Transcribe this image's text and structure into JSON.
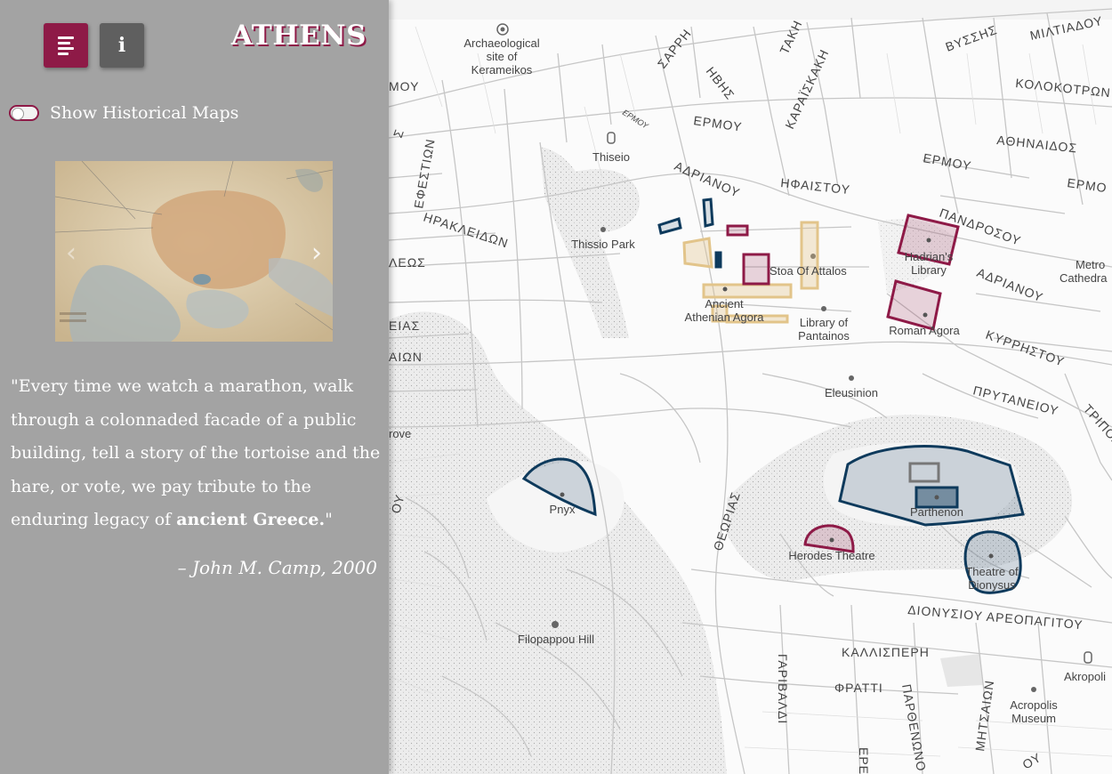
{
  "sidebar": {
    "title": "ATHENS",
    "menu_button_icon": "menu-icon",
    "info_button_icon": "info-icon",
    "info_glyph": "i",
    "toggle_label": "Show Historical Maps",
    "toggle_on": false,
    "carousel": {
      "prev_glyph": "‹",
      "next_glyph": "›"
    },
    "quote_part1": "\"Every time we watch a marathon, walk through a colonnaded facade of a public building, tell a story of the tortoise and the hare, or vote, we pay tribute to the enduring legacy of ",
    "quote_bold": "ancient Greece.",
    "quote_end": "\"",
    "attribution": "– John M. Camp, 2000"
  },
  "colors": {
    "accent": "#8e1a47",
    "sidebar": "#a3a3a3",
    "navy": "#0e3a5c",
    "sand": "#e2c48a"
  },
  "map": {
    "places": {
      "keramikos": [
        "Archaeological",
        "site of",
        "Kerameikos"
      ],
      "thiseio": "Thiseio",
      "thissio_park": "Thissio Park",
      "stoa": "Stoa Of Attalos",
      "agora": [
        "Ancient",
        "Athenian Agora"
      ],
      "pantainos": [
        "Library of",
        "Pantainos"
      ],
      "hadrians": [
        "Hadrian's",
        "Library"
      ],
      "roman_agora": "Roman Agora",
      "metro": [
        "Metro",
        "Cathedra"
      ],
      "eleusinion": "Eleusinion",
      "parthenon": "Parthenon",
      "pnyx": "Pnyx",
      "herodes": "Herodes Theatre",
      "dionysus": [
        "Theatre of",
        "Dionysus"
      ],
      "filopappou": "Filopappou Hill",
      "akropoli": "Akropoli",
      "acropolis_museum": [
        "Acropolis",
        "Museum"
      ],
      "grove": "rove"
    },
    "streets": {
      "sarri": "ΣΑΡΡΗ",
      "ivis": "ΗΒΗΣ",
      "taki": "ΤΑΚΗ",
      "karaiskaki": "ΚΑΡΑΪΣΚΑΚΗ",
      "vyssis": "ΒΥΣΣΗΣ",
      "miltiadou": "ΜΙΛΤΙΑΔΟΥ",
      "kolokotroni": "ΚΟΛΟΚΟΤΡΩΝ",
      "ermou1": "ΕΡΜΟΥ",
      "ermou_small": "ΕΡΜΟΥ",
      "ermou2": "ΕΡΜΟΥ",
      "ermou3": "ΕΡΜΟ",
      "athinaidos": "ΑΘΗΝΑΙΔΟΣ",
      "adrianou1": "ΑΔΡΙΑΝΟΥ",
      "ifaistou": "ΗΦΑΙΣΤΟΥ",
      "pandrosou": "ΠΑΝΔΡΟΣΟΥ",
      "adrianou2": "ΑΔΡΙΑΝΟΥ",
      "kyrristou": "ΚΥΡΡΗΣΤΟΥ",
      "prytaneiou": "ΠΡΥΤΑΝΕΙΟΥ",
      "tripodon": "ΤΡΙΠΟΔΩΝ",
      "efestion": "ΕΦΕΣΤΙΩΝ",
      "irakleidon": "ΗΡΑΚΛΕΙΔΩΝ",
      "moy": "ΜΟΥ",
      "ls": "ΛΕΩΣ",
      "eias": "ΕΙΑΣ",
      "aion": "ΑΙΩΝ",
      "oy": "ΟΥ",
      "sigma": "Σ",
      "theorias": "ΘΕΩΡΙΑΣ",
      "dionysiou": "ΔΙΟΝΥΣΙΟΥ ΑΡΕΟΠΑΓΙΤΟΥ",
      "kallisperi": "ΚΑΛΛΙΣΠΕΡΗ",
      "fratti": "ΦΡΑΤΤΙ",
      "garivaldi": "ΓΑΡΙΒΑΛΔΙ",
      "parthenonos": "ΠΑΡΘΕΝΩΝΟ",
      "mitseon": "ΜΗΤΣΑΙΩΝ",
      "ere": "ΕΡΕ",
      "oy2": "ΟΥ"
    }
  }
}
